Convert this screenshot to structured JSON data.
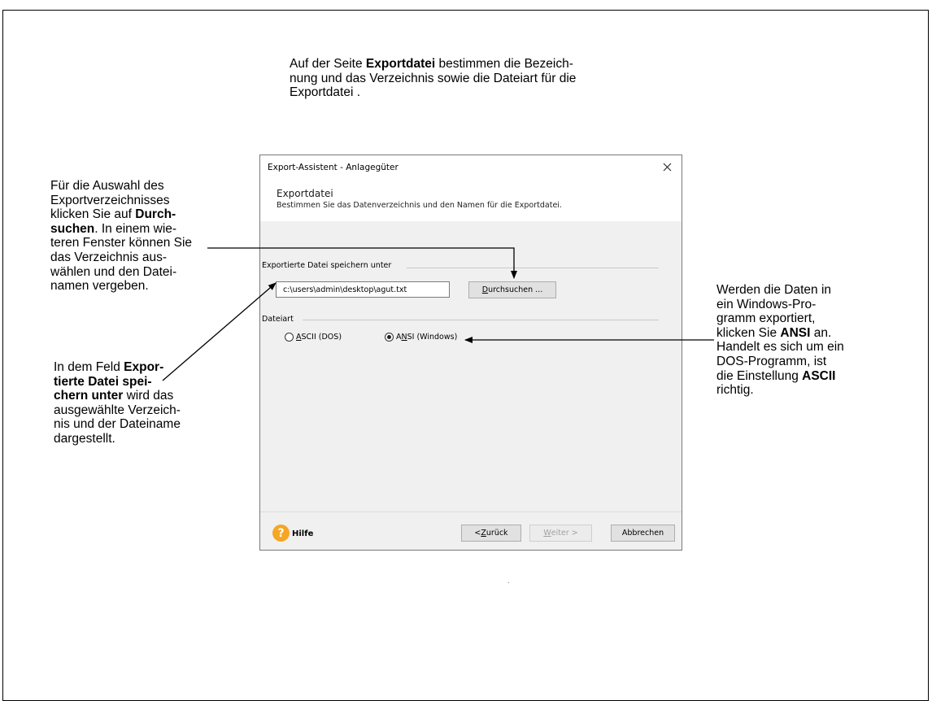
{
  "annotations": {
    "top": {
      "line1_pre": "Auf der Seite ",
      "line1_bold": "Exportdatei",
      "line1_post": " bestimmen die Bezeich-",
      "line2": "nung und das Verzeichnis sowie die Dateiart für die",
      "line3": "Exportdatei ."
    },
    "left_upper": {
      "line1": "Für die Auswahl des",
      "line2": "Exportverzeichnisses",
      "line3_pre": "klicken Sie auf ",
      "line3_bold": "Durch-",
      "line4_bold": "suchen",
      "line4_post": ". In einem wie-",
      "line5": "teren Fenster können Sie",
      "line6": "das Verzeichnis aus-",
      "line7": "wählen und den Datei-",
      "line8": "namen vergeben."
    },
    "left_lower": {
      "line1_pre": "In dem Feld ",
      "line1_bold": "Expor-",
      "line2_bold": "tierte Datei spei-",
      "line3_bold": "chern unter",
      "line3_post": " wird das",
      "line4": "ausgewählte Verzeich-",
      "line5": "nis und der Dateiname",
      "line6": "dargestellt."
    },
    "right": {
      "line1": "Werden die Daten in",
      "line2": "ein Windows-Pro-",
      "line3": "gramm exportiert,",
      "line4_pre": "klicken Sie ",
      "line4_bold": "ANSI",
      "line4_post": " an.",
      "line5": "Handelt es sich um ein",
      "line6": "DOS-Programm, ist",
      "line7_pre": "die Einstellung ",
      "line7_bold": "ASCII",
      "line8": "richtig."
    }
  },
  "dialog": {
    "title": "Export-Assistent - Anlagegüter",
    "close_glyph": "✕",
    "header_title": "Exportdatei",
    "header_subtitle": "Bestimmen Sie das Datenverzeichnis und den Namen für die Exportdatei.",
    "save_group_label": "Exportierte Datei speichern unter",
    "path_value": "c:\\users\\admin\\desktop\\agut.txt",
    "browse_accel": "D",
    "browse_rest": "urchsuchen ...",
    "filetype_group_label": "Dateiart",
    "radio_ascii_accel": "A",
    "radio_ascii_rest": "SCII (DOS)",
    "radio_ansi_pre": "A",
    "radio_ansi_accel": "N",
    "radio_ansi_rest": "SI (Windows)",
    "selected_filetype": "ANSI",
    "help_glyph": "?",
    "help_label": "Hilfe",
    "back_pre": "< ",
    "back_accel": "Z",
    "back_rest": "urück",
    "next_accel": "W",
    "next_rest": "eiter >",
    "cancel_label": "Abbrechen"
  }
}
